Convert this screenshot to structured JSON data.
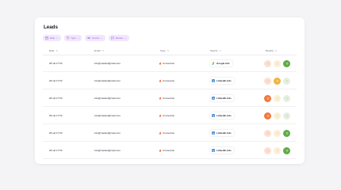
{
  "title": "Leads",
  "filters": [
    {
      "label": "Date",
      "icon": "calendar-icon"
    },
    {
      "label": "Type",
      "icon": "tag-icon"
    },
    {
      "label": "Source",
      "icon": "link-icon"
    },
    {
      "label": "Review",
      "icon": "chat-icon"
    }
  ],
  "columns": {
    "date": "Date",
    "email": "Email",
    "type": "Type",
    "source": "Source",
    "review": "Review"
  },
  "rows": [
    {
      "date": "28 okt 17:53",
      "email": "info@marked@mail.com",
      "type": "Conversion",
      "source": "Google Ads",
      "review": "happy"
    },
    {
      "date": "28 okt 17:53",
      "email": "info@marked@mail.com",
      "type": "Conversion",
      "source": "LinkedIn Ads",
      "review": "neutral"
    },
    {
      "date": "28 okt 17:53",
      "email": "info@marked@mail.com",
      "type": "Conversion",
      "source": "LinkedIn Ads",
      "review": "sad"
    },
    {
      "date": "28 okt 17:53",
      "email": "info@marked@mail.com",
      "type": "Conversion",
      "source": "LinkedIn Ads",
      "review": "sad"
    },
    {
      "date": "28 okt 17:53",
      "email": "info@marked@mail.com",
      "type": "Conversion",
      "source": "LinkedIn Ads",
      "review": "happy"
    },
    {
      "date": "28 okt 17:53",
      "email": "info@marked@mail.com",
      "type": "Conversion",
      "source": "LinkedIn Ads",
      "review": "happy"
    }
  ],
  "colors": {
    "accent": "#9a58e5",
    "chip_bg": "#f1e7fd",
    "conversion": "#f26b3a",
    "linkedin": "#0a66c2",
    "google_blue": "#4285f4",
    "google_yellow": "#fbbc04",
    "google_green": "#34a853",
    "face_sad": "#f1783f",
    "face_neutral": "#f3b33c",
    "face_happy": "#5fab45",
    "face_sad_muted": "#fbe0d3",
    "face_neutral_muted": "#fbefd6",
    "face_happy_muted": "#e5efdf"
  }
}
